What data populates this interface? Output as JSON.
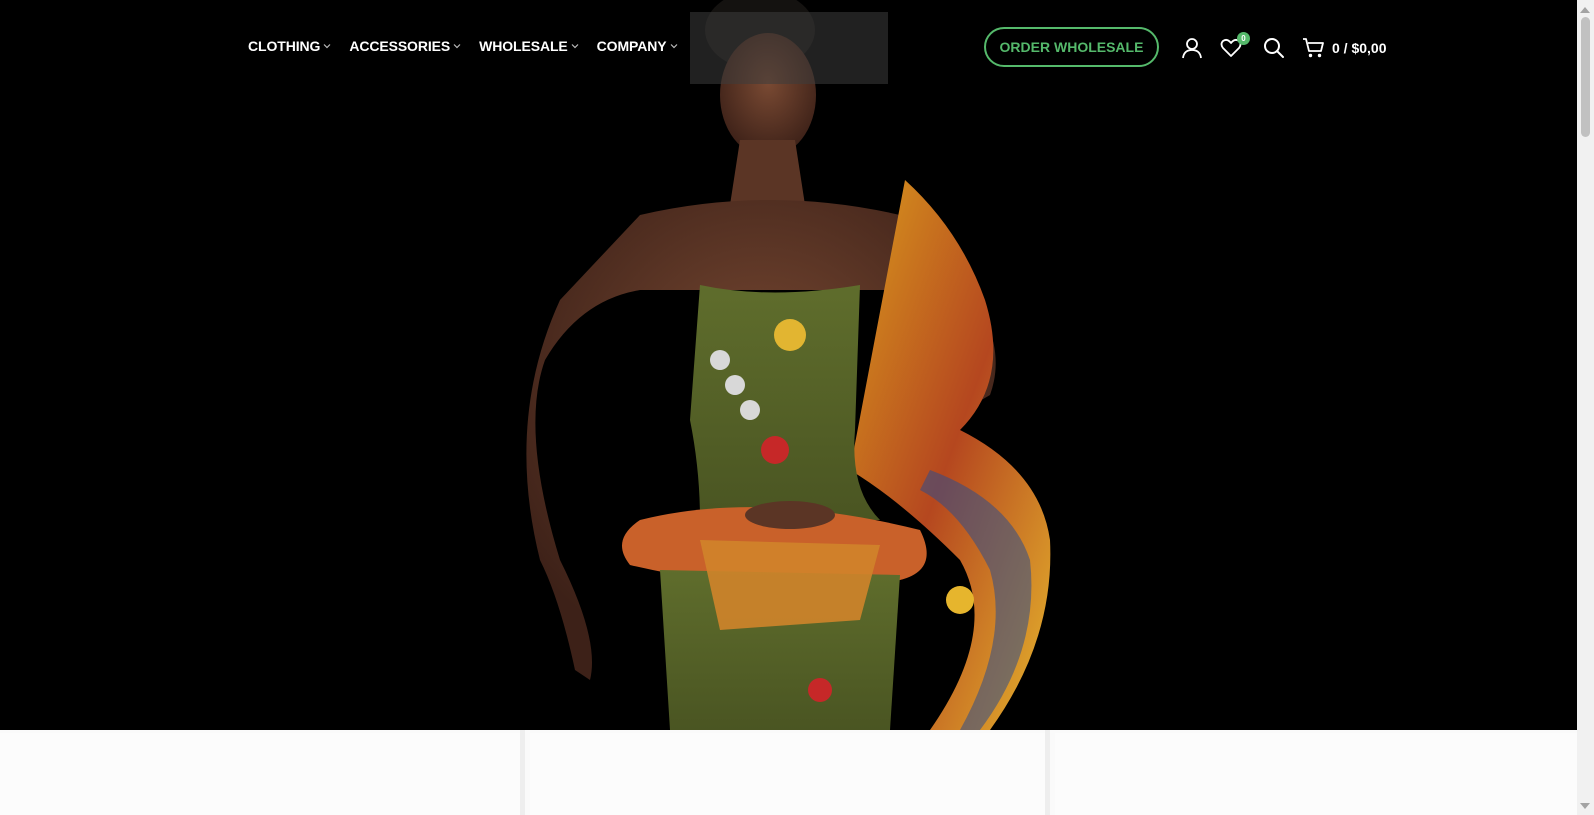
{
  "nav": {
    "items": [
      {
        "label": "CLOTHING"
      },
      {
        "label": "ACCESSORIES"
      },
      {
        "label": "WHOLESALE"
      },
      {
        "label": "COMPANY"
      }
    ]
  },
  "header": {
    "cta_label": "ORDER WHOLESALE",
    "wishlist_count": "0",
    "cart_label": "0 / $0,00"
  },
  "icons": [
    "account-icon",
    "heart-icon",
    "search-icon",
    "cart-icon",
    "chevron-down-icon"
  ],
  "colors": {
    "accent": "#55b96b",
    "hero_background": "#000000",
    "nav_text": "#ffffff"
  }
}
